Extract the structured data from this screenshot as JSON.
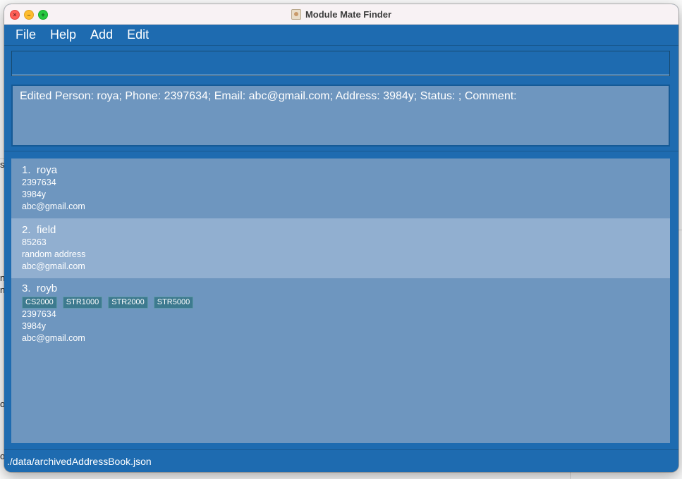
{
  "window": {
    "title": "Module Mate Finder"
  },
  "background_fragments": [
    "s",
    "n",
    "n",
    "o",
    "o"
  ],
  "menu": [
    {
      "label": "File"
    },
    {
      "label": "Help"
    },
    {
      "label": "Add"
    },
    {
      "label": "Edit"
    }
  ],
  "command_box": {
    "value": "",
    "placeholder": ""
  },
  "result": {
    "text": "Edited Person: roya; Phone: 2397634; Email: abc@gmail.com; Address: 3984y; Status: ; Comment:"
  },
  "persons": [
    {
      "index": "1.",
      "name": "roya",
      "tags": [],
      "phone": "2397634",
      "address": "3984y",
      "email": "abc@gmail.com"
    },
    {
      "index": "2.",
      "name": "field",
      "tags": [],
      "phone": "85263",
      "address": "random address",
      "email": "abc@gmail.com"
    },
    {
      "index": "3.",
      "name": "royb",
      "tags": [
        "CS2000",
        "STR1000",
        "STR2000",
        "STR5000"
      ],
      "phone": "2397634",
      "address": "3984y",
      "email": "abc@gmail.com"
    }
  ],
  "status_bar": {
    "path": "./data/archivedAddressBook.json"
  },
  "colors": {
    "primary": "#1e6bb0",
    "panel": "#6e96bf",
    "selected_row": "#91afd0",
    "tag": "#3d7a8f"
  },
  "icons": [
    "close-icon",
    "minimize-icon",
    "maximize-icon",
    "address-book-app-icon"
  ]
}
